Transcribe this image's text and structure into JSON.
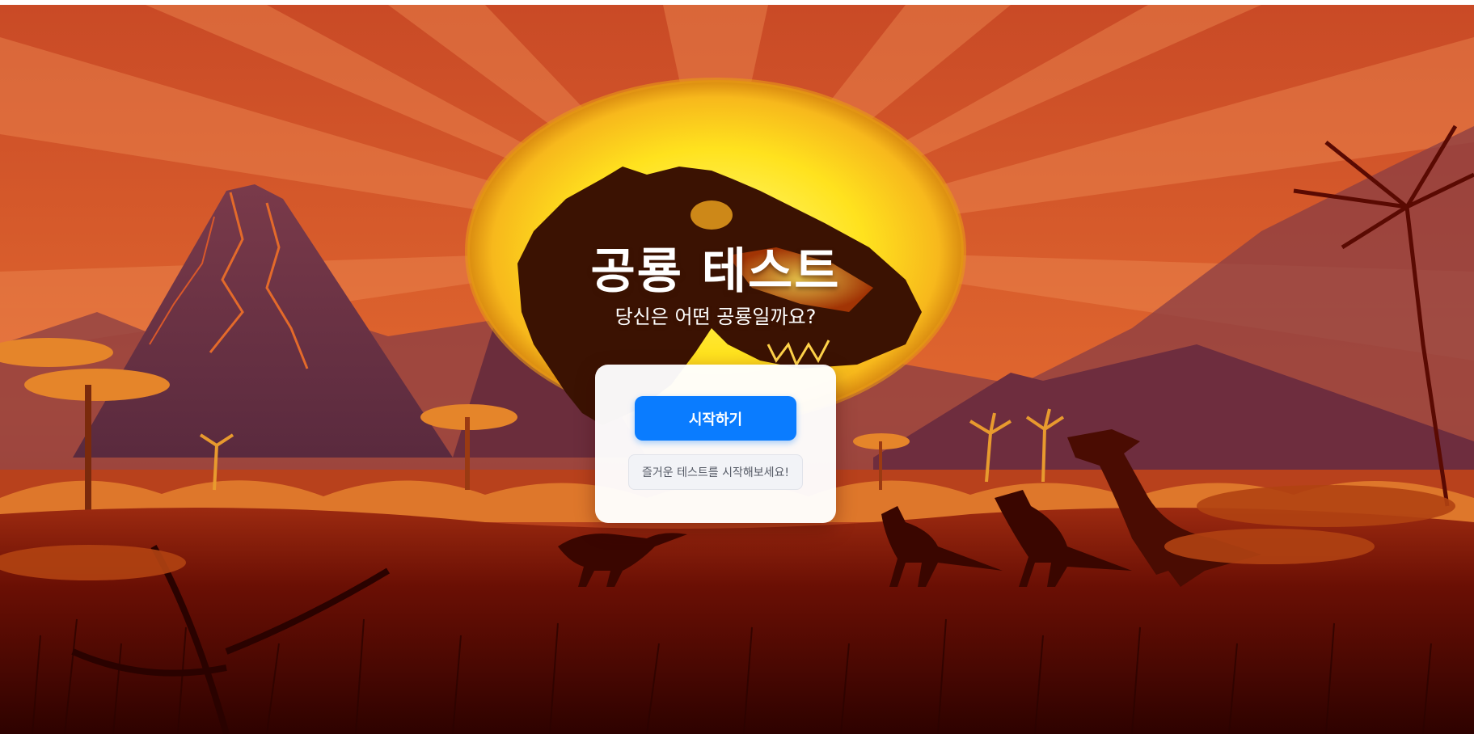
{
  "page": {
    "title": "공룡 테스트",
    "subtitle": "당신은 어떤 공룡일까요?"
  },
  "card": {
    "start_button_label": "시작하기",
    "hint_text": "즐거운 테스트를 시작해보세요!"
  },
  "colors": {
    "sky": "#d4552a",
    "sun": "#ffd21f",
    "ground": "#3a0400",
    "accent": "#0a7cff"
  },
  "icons": [
    "sun-emblem",
    "t-rex-skull-silhouette",
    "volcano",
    "palm-tree",
    "raptor-silhouette"
  ]
}
